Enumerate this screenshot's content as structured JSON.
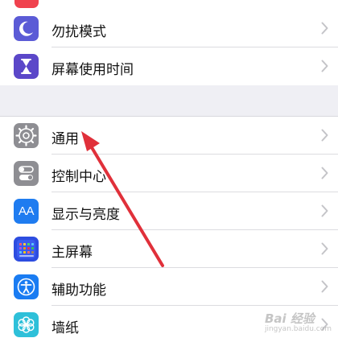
{
  "settings": {
    "items": [
      {
        "label": "勿扰模式",
        "icon": "moon-icon",
        "color": "#5b5bd6"
      },
      {
        "label": "屏幕使用时间",
        "icon": "hourglass-icon",
        "color": "#5b47c9"
      },
      {
        "label": "通用",
        "icon": "gear-icon",
        "color": "#8e8e93"
      },
      {
        "label": "控制中心",
        "icon": "toggles-icon",
        "color": "#8e8e93"
      },
      {
        "label": "显示与亮度",
        "icon": "aa-text-icon",
        "color": "#1f7cf0",
        "icon_text": "AA"
      },
      {
        "label": "主屏幕",
        "icon": "grid-icon",
        "color": "#2d4de0"
      },
      {
        "label": "辅助功能",
        "icon": "accessibility-icon",
        "color": "#1a7cf2"
      },
      {
        "label": "墙纸",
        "icon": "flower-icon",
        "color": "#2ec0d9"
      }
    ]
  },
  "annotation": {
    "arrow_color": "#e0303a"
  },
  "watermark": {
    "brand": "Bai 经验",
    "url": "jingyan.baidu.com"
  }
}
